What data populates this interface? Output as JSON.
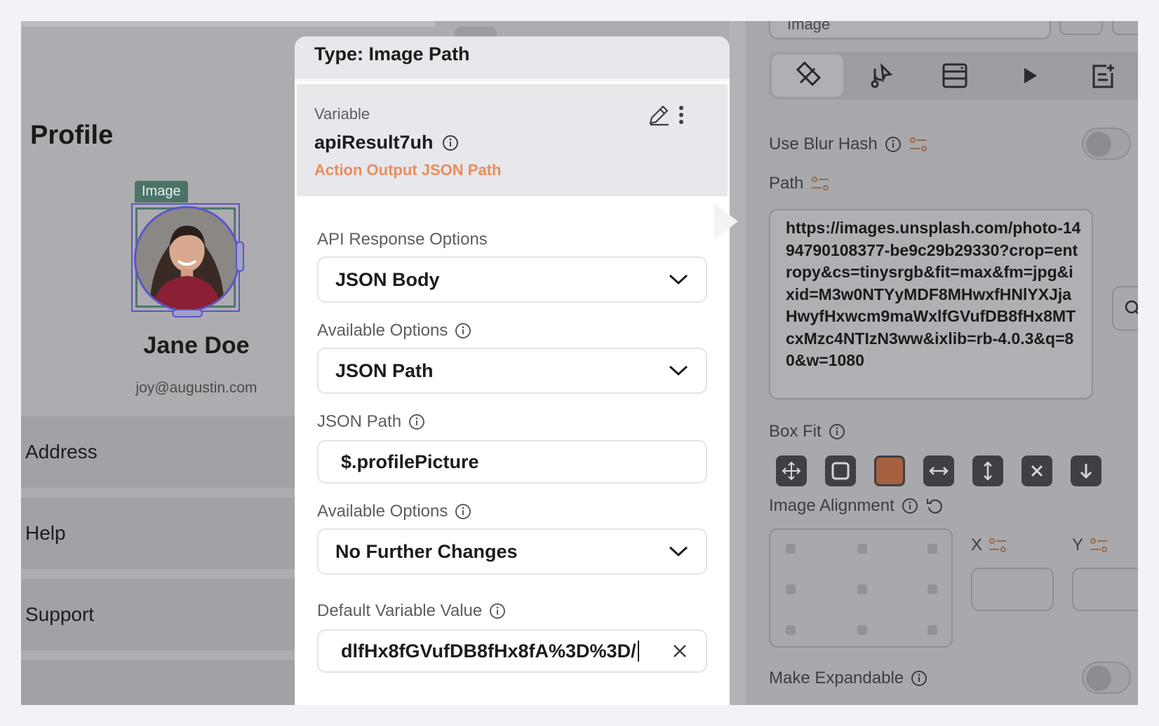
{
  "canvas": {
    "profile_title": "Profile",
    "image_tag": "Image",
    "user_name": "Jane Doe",
    "user_email": "joy@augustin.com",
    "nav_items": [
      "Address",
      "Help",
      "Support"
    ]
  },
  "dialog": {
    "title": "Type: Image Path",
    "variable_label": "Variable",
    "variable_name": "apiResult7uh",
    "variable_source": "Action Output JSON Path",
    "api_response_label": "API Response Options",
    "api_response_value": "JSON Body",
    "available_options_label_1": "Available Options",
    "available_options_value_1": "JSON Path",
    "json_path_label": "JSON Path",
    "json_path_value": "$.profilePicture",
    "available_options_label_2": "Available Options",
    "available_options_value_2": "No Further Changes",
    "default_value_label": "Default Variable Value",
    "default_value_visible": "/dlfHx8fGVufDB8fHx8fA%3D%3D"
  },
  "panel": {
    "top_field_value": "Image",
    "use_blur_hash_label": "Use Blur Hash",
    "path_label": "Path",
    "path_value": "https://images.unsplash.com/photo-1494790108377-be9c29b29330?crop=entropy&cs=tinysrgb&fit=max&fm=jpg&ixid=M3w0NTYyMDF8MHwxfHNlYXJjaHwyfHxwcm9maWxlfGVufDB8fHx8MTcxMzc4NTIzN3ww&ixlib=rb-4.0.3&q=80&w=1080",
    "box_fit_label": "Box Fit",
    "image_alignment_label": "Image Alignment",
    "x_label": "X",
    "y_label": "Y",
    "make_expandable_label": "Make Expandable"
  },
  "colors": {
    "accent_orange": "#e98d5b",
    "selection_purple": "#5b55c9",
    "tag_green": "#4b7468",
    "selected_boxfit": "#a4603f"
  }
}
